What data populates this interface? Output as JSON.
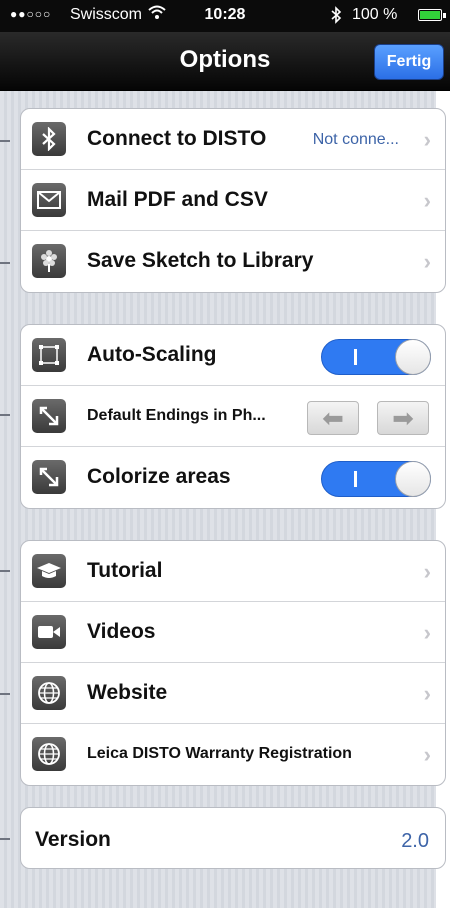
{
  "status_bar": {
    "signal_dots": "●●○○○",
    "carrier": "Swisscom",
    "time": "10:28",
    "battery_text": "100 %",
    "battery_color": "#32d33a"
  },
  "nav": {
    "title": "Options",
    "done_label": "Fertig",
    "done_color": "#2b6fe6"
  },
  "groups": {
    "connect": {
      "connect_label": "Connect to DISTO",
      "connect_status": "Not conne...",
      "mail_label": "Mail PDF and CSV",
      "save_label": "Save Sketch to Library"
    },
    "settings": {
      "autoscale_label": "Auto-Scaling",
      "autoscale_on": true,
      "endings_label": "Default Endings in Ph...",
      "colorize_label": "Colorize areas",
      "colorize_on": true
    },
    "help": {
      "tutorial_label": "Tutorial",
      "videos_label": "Videos",
      "website_label": "Website",
      "warranty_label": "Leica DISTO Warranty Registration"
    },
    "version": {
      "label": "Version",
      "value": "2.0"
    }
  },
  "icons": {
    "bluetooth": "bluetooth-icon",
    "mail": "mail-icon",
    "save": "flower-icon",
    "scaling": "frame-icon",
    "endings": "diagonal-arrow-icon",
    "colorize": "diagonal-arrow-icon",
    "tutorial": "graduation-cap-icon",
    "videos": "video-camera-icon",
    "website": "globe-icon",
    "warranty": "globe-icon"
  },
  "colors": {
    "accent": "#2f7af2",
    "detail_text": "#3d64a8"
  }
}
